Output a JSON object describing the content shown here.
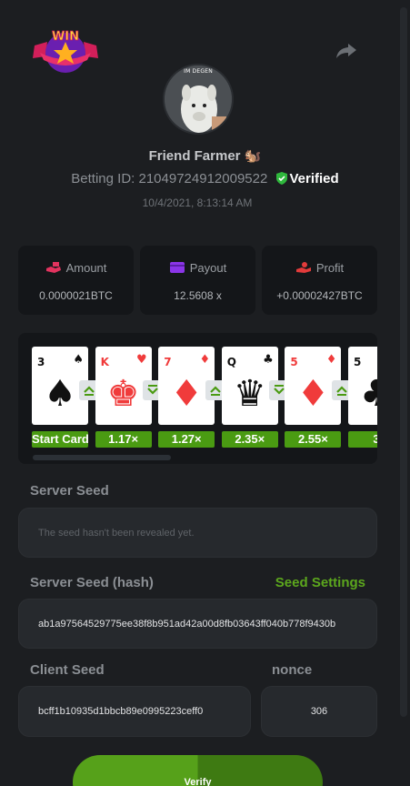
{
  "header": {
    "logo_text": "WIN",
    "share_icon": "share-icon"
  },
  "profile": {
    "avatar_label": "IM DEGEN",
    "username": "Friend Farmer 🐿️",
    "betting_id_label": "Betting ID: 21049724912009522",
    "verified_label": "Verified",
    "timestamp": "10/4/2021, 8:13:14 AM"
  },
  "stats": {
    "amount": {
      "label": "Amount",
      "value": "0.0000021BTC",
      "icon": "money-hand-icon"
    },
    "payout": {
      "label": "Payout",
      "value": "12.5608 x",
      "icon": "wallet-icon"
    },
    "profit": {
      "label": "Profit",
      "value": "+0.00002427BTC",
      "icon": "profit-hand-icon"
    }
  },
  "cards": [
    {
      "rank": "3",
      "suit": "♠",
      "color": "black",
      "face": "♠",
      "multiplier": "Start Card",
      "arrow": "up"
    },
    {
      "rank": "K",
      "suit": "♥",
      "color": "red",
      "face": "♚",
      "multiplier": "1.17×",
      "arrow": "down"
    },
    {
      "rank": "7",
      "suit": "♦",
      "color": "red",
      "face": "♦",
      "multiplier": "1.27×",
      "arrow": "up"
    },
    {
      "rank": "Q",
      "suit": "♣",
      "color": "black",
      "face": "♛",
      "multiplier": "2.35×",
      "arrow": "down"
    },
    {
      "rank": "5",
      "suit": "♦",
      "color": "red",
      "face": "♦",
      "multiplier": "2.55×",
      "arrow": "up"
    },
    {
      "rank": "5",
      "suit": "♣",
      "color": "black",
      "face": "♣",
      "multiplier": "3",
      "arrow": ""
    }
  ],
  "seeds": {
    "server_seed_label": "Server Seed",
    "server_seed_placeholder": "The seed hasn't been revealed yet.",
    "server_seed_hash_label": "Server Seed (hash)",
    "seed_settings_label": "Seed Settings",
    "server_seed_hash": "ab1a97564529775ee38f8b951ad42a00d8fb03643ff040b778f9430b",
    "client_seed_label": "Client Seed",
    "client_seed": "bcff1b10935d1bbcb89e0995223ceff0",
    "nonce_label": "nonce",
    "nonce": "306"
  },
  "actions": {
    "verify_label": "Verify"
  },
  "colors": {
    "accent_green": "#5ca71d",
    "card_red": "#f03b3b",
    "panel_bg": "#1c1e21"
  }
}
